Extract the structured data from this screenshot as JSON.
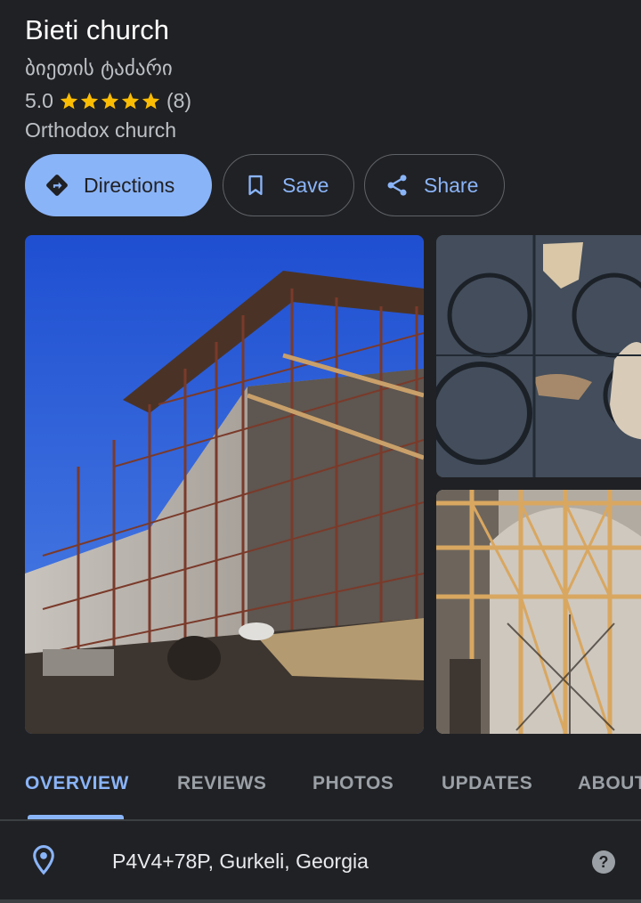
{
  "place": {
    "name": "Bieti church",
    "native_name": "ბიეთის ტაძარი",
    "rating": "5.0",
    "review_count": "(8)",
    "stars": 5,
    "category": "Orthodox church"
  },
  "actions": {
    "directions": "Directions",
    "save": "Save",
    "share": "Share"
  },
  "tabs": [
    {
      "label": "OVERVIEW",
      "active": true
    },
    {
      "label": "REVIEWS"
    },
    {
      "label": "PHOTOS"
    },
    {
      "label": "UPDATES"
    },
    {
      "label": "ABOUT"
    }
  ],
  "address": {
    "text": "P4V4+78P, Gurkeli, Georgia",
    "help_icon": "?"
  },
  "colors": {
    "background": "#202124",
    "accent": "#8ab4f8",
    "star": "#fbbc04",
    "muted": "#bdc1c6"
  }
}
